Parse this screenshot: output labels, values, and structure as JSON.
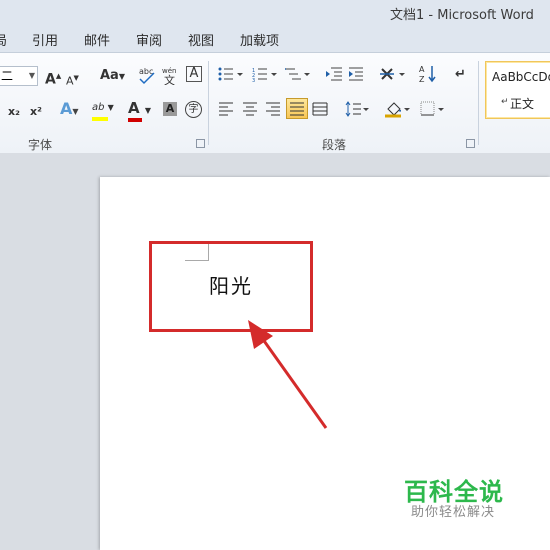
{
  "window": {
    "title": "文档1 - Microsoft Word"
  },
  "tabs": [
    {
      "label": "局",
      "id": "layout"
    },
    {
      "label": "引用",
      "id": "references"
    },
    {
      "label": "邮件",
      "id": "mailings"
    },
    {
      "label": "审阅",
      "id": "review"
    },
    {
      "label": "视图",
      "id": "view"
    },
    {
      "label": "加载项",
      "id": "addins"
    }
  ],
  "font_group": {
    "label": "字体",
    "font_size_value": "二",
    "grow_font": "A",
    "shrink_font": "A",
    "change_case": "Aa",
    "subscript": "x₂",
    "superscript": "x²",
    "text_effect": "A",
    "highlight": "ab",
    "font_color": "A",
    "char_shading": "A",
    "enclose": "字"
  },
  "paragraph_group": {
    "label": "段落"
  },
  "styles": {
    "sample": "AaBbCcDd",
    "name": "正文"
  },
  "document": {
    "text": "阳光"
  },
  "watermark": {
    "main": "百科全说",
    "sub": "助你轻松解决"
  },
  "colors": {
    "highlight_border": "#d42b2b",
    "arrow": "#d42b2b",
    "font_color_bar": "#d00000",
    "highlight_bar": "#ffff00",
    "watermark_green": "#2db84c"
  }
}
